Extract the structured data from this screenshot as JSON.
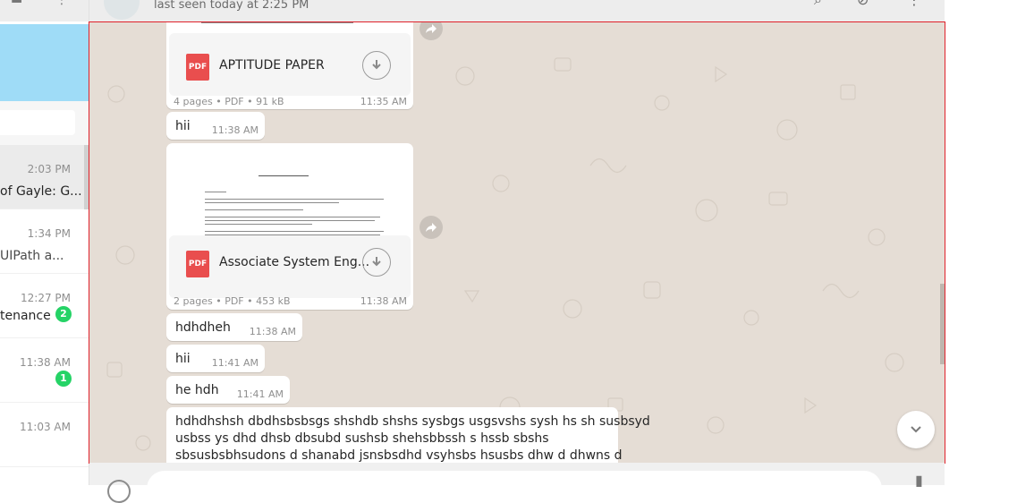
{
  "header": {
    "contact_status": "last seen today at 2:25 PM"
  },
  "sidebar": {
    "chats": [
      {
        "time": "2:03 PM",
        "preview": "of Gayle: G...",
        "unread": "",
        "active": true
      },
      {
        "time": "1:34 PM",
        "preview": " UIPath a...",
        "unread": "",
        "active": false
      },
      {
        "time": "12:27 PM",
        "preview": "tenance",
        "unread": "2",
        "active": false
      },
      {
        "time": "11:38 AM",
        "preview": "",
        "unread": "1",
        "active": false
      },
      {
        "time": "11:03 AM",
        "preview": "",
        "unread": "",
        "active": false
      }
    ]
  },
  "messages": {
    "doc1": {
      "name": "APTITUDE PAPER",
      "pages": "4 pages",
      "type": "PDF",
      "size": "91 kB",
      "time": "11:35 AM",
      "icon_label": "PDF"
    },
    "msg_hii_1": {
      "text": "hii",
      "time": "11:38 AM"
    },
    "doc2": {
      "name": "Associate System Eng...",
      "pages": "2 pages",
      "type": "PDF",
      "size": "453 kB",
      "time": "11:38 AM",
      "icon_label": "PDF"
    },
    "msg_hdhdheh": {
      "text": "hdhdheh",
      "time": "11:38 AM"
    },
    "msg_hii_2": {
      "text": "hii",
      "time": "11:41 AM"
    },
    "msg_he_hdh": {
      "text": "he hdh",
      "time": "11:41 AM"
    },
    "msg_long": {
      "line1": "hdhdhshsh dbdhsbsbsgs shshdb shshs sysbgs usgsvshs sysh hs sh susbsyd",
      "line2": "usbss ys dhd  dhsb dbsubd sushsb shehsbbssh s hssb  sbshs",
      "line3": "sbsusbsbhsudons d shanabd  jsnsbsdhd vsyhsbs hsusbs dhw d dhwns d"
    },
    "dot": "•"
  },
  "colors": {
    "chat_background": "#e5ddd5",
    "highlight_border": "#e0212b",
    "unread_badge": "#25d366",
    "pdf_icon": "#e94e4e"
  },
  "icons": [
    "forward-icon",
    "download-icon",
    "chevron-down-icon",
    "pdf-icon",
    "emoji-icon",
    "mic-icon"
  ]
}
